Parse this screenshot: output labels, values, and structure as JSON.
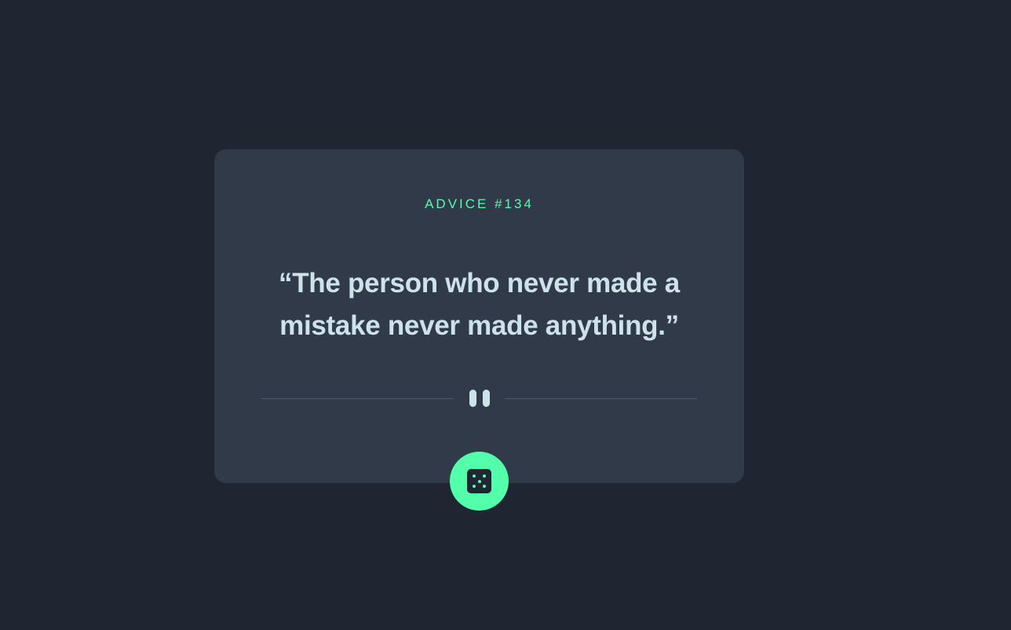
{
  "advice": {
    "label": "ADVICE #134",
    "quote": "“The person who never made a mistake never made anything.”"
  },
  "colors": {
    "accent": "#53ffaa",
    "background": "#1f2632",
    "card": "#313a48",
    "text": "#cee3e9"
  },
  "button": {
    "icon": "dice-icon"
  }
}
